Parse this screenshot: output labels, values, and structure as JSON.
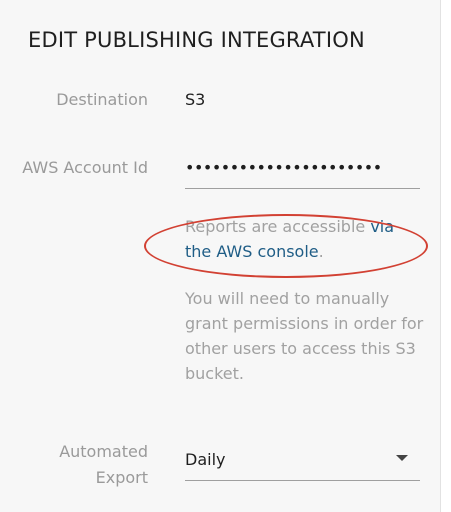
{
  "page": {
    "title": "EDIT PUBLISHING INTEGRATION"
  },
  "fields": {
    "destination": {
      "label": "Destination",
      "value": "S3"
    },
    "aws_account_id": {
      "label": "AWS Account Id",
      "masked_value": "••••••••••••••••••••••"
    },
    "reports_note": {
      "prefix": "Reports are accessible ",
      "link_text": "via the AWS console",
      "suffix": "."
    },
    "permissions_note": {
      "text": "You will need to manually grant permissions in order for other users to access this S3 bucket."
    },
    "automated_export": {
      "label_line1": "Automated",
      "label_line2": "Export",
      "selected": "Daily",
      "caret_icon": "chevron-down-icon"
    }
  },
  "colors": {
    "link": "#1f5d86",
    "highlight_oval": "#d24133"
  }
}
